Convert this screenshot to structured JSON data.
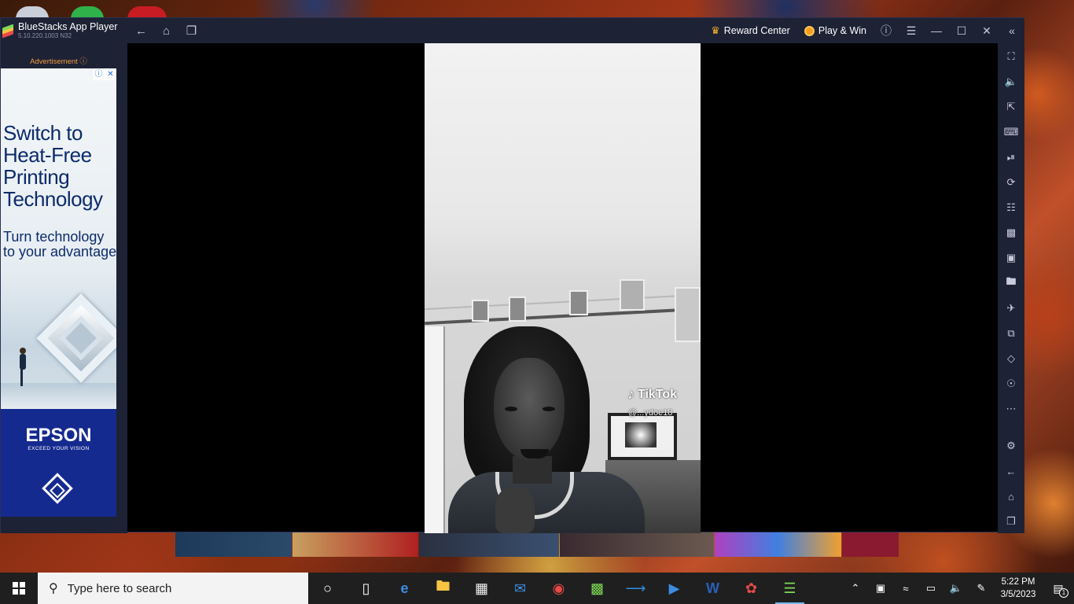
{
  "window": {
    "app_title": "BlueStacks App Player",
    "version": "5.10.220.1003 N32",
    "reward_center": "Reward Center",
    "play_win": "Play & Win"
  },
  "ad": {
    "label": "Advertisement ⓘ",
    "info_glyph": "ⓘ",
    "close_glyph": "✕",
    "headline": "Switch to Heat-Free Printing Technology",
    "subline": "Turn technology to your advantage",
    "brand": "EPSON",
    "tagline": "EXCEED YOUR VISION"
  },
  "video": {
    "watermark": "TikTok",
    "username": "@...ydoe18"
  },
  "right_bar_icons": [
    "fullscreen-icon",
    "volume-icon",
    "cursor-icon",
    "keyboard-icon",
    "record-icon",
    "rotate-icon",
    "gamepad-icon",
    "apk-icon",
    "screenshot-icon",
    "folder-icon",
    "airplane-icon",
    "multi-instance-icon",
    "eraser-icon",
    "location-icon",
    "more-icon",
    "settings-icon",
    "back-icon",
    "home-icon",
    "recent-apps-icon"
  ],
  "taskbar": {
    "search_placeholder": "Type here to search",
    "time": "5:22 PM",
    "date": "3/5/2023",
    "notification_count": "1"
  },
  "colors": {
    "titlebar": "#1d2235",
    "taskbar": "#1f1f1f",
    "accent": "#76b9ed",
    "ad_blue": "#152a8f",
    "ad_label": "#f39a3e"
  }
}
